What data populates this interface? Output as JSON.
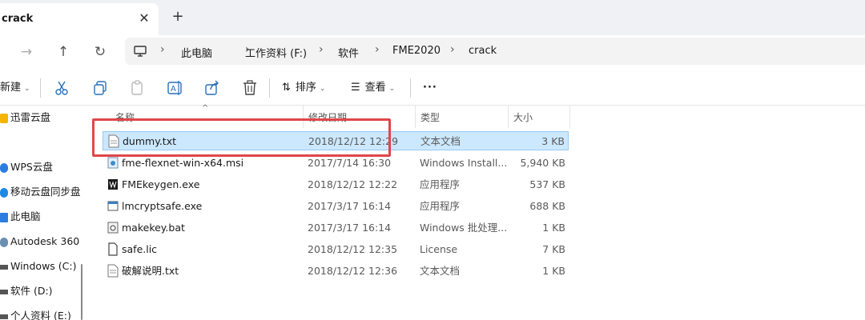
{
  "tab": {
    "title": "crack",
    "close": "✕",
    "new": "+"
  },
  "nav": {
    "forward": "→",
    "up": "↑",
    "refresh": "↻"
  },
  "address": {
    "crumbs": [
      "此电脑",
      "工作资料 (F:)",
      "软件",
      "FME2020",
      "crack"
    ],
    "separator": "›"
  },
  "toolbar": {
    "new_label": "新建",
    "sort_label": "排序",
    "view_label": "查看",
    "more_label": "···"
  },
  "sidebar": {
    "items": [
      {
        "label": "迅雷云盘",
        "color": "#f4b400"
      },
      {
        "label": "WPS云盘",
        "color": "#2a7de1"
      },
      {
        "label": "移动云盘同步盘",
        "color": "#1e88e5"
      },
      {
        "label": "此电脑",
        "color": "#2a7de1"
      },
      {
        "label": "Autodesk 360",
        "color": "#6a8fb0"
      },
      {
        "label": "Windows (C:)",
        "color": "#555555"
      },
      {
        "label": "软件 (D:)",
        "color": "#555555"
      },
      {
        "label": "个人资料 (E:)",
        "color": "#555555"
      }
    ]
  },
  "columns": {
    "name": "名称",
    "date": "修改日期",
    "type": "类型",
    "size": "大小"
  },
  "files": [
    {
      "name": "dummy.txt",
      "date": "2018/12/12 12:29",
      "type": "文本文档",
      "size": "3 KB",
      "icon": "text-file-icon"
    },
    {
      "name": "fme-flexnet-win-x64.msi",
      "date": "2017/7/14 16:30",
      "type": "Windows Install...",
      "size": "5,940 KB",
      "icon": "msi-file-icon"
    },
    {
      "name": "FMEkeygen.exe",
      "date": "2018/12/12 12:22",
      "type": "应用程序",
      "size": "537 KB",
      "icon": "exe-file-icon"
    },
    {
      "name": "lmcryptsafe.exe",
      "date": "2017/3/17 16:14",
      "type": "应用程序",
      "size": "688 KB",
      "icon": "app-window-icon"
    },
    {
      "name": "makekey.bat",
      "date": "2017/3/17 16:14",
      "type": "Windows 批处理...",
      "size": "1 KB",
      "icon": "bat-file-icon"
    },
    {
      "name": "safe.lic",
      "date": "2018/12/12 12:35",
      "type": "License",
      "size": "7 KB",
      "icon": "lic-file-icon"
    },
    {
      "name": "破解说明.txt",
      "date": "2018/12/12 12:36",
      "type": "文本文档",
      "size": "1 KB",
      "icon": "text-file-icon"
    }
  ],
  "colors": {
    "selection": "#cce8ff",
    "highlight": "#e0464a",
    "accent": "#2a7de1"
  }
}
